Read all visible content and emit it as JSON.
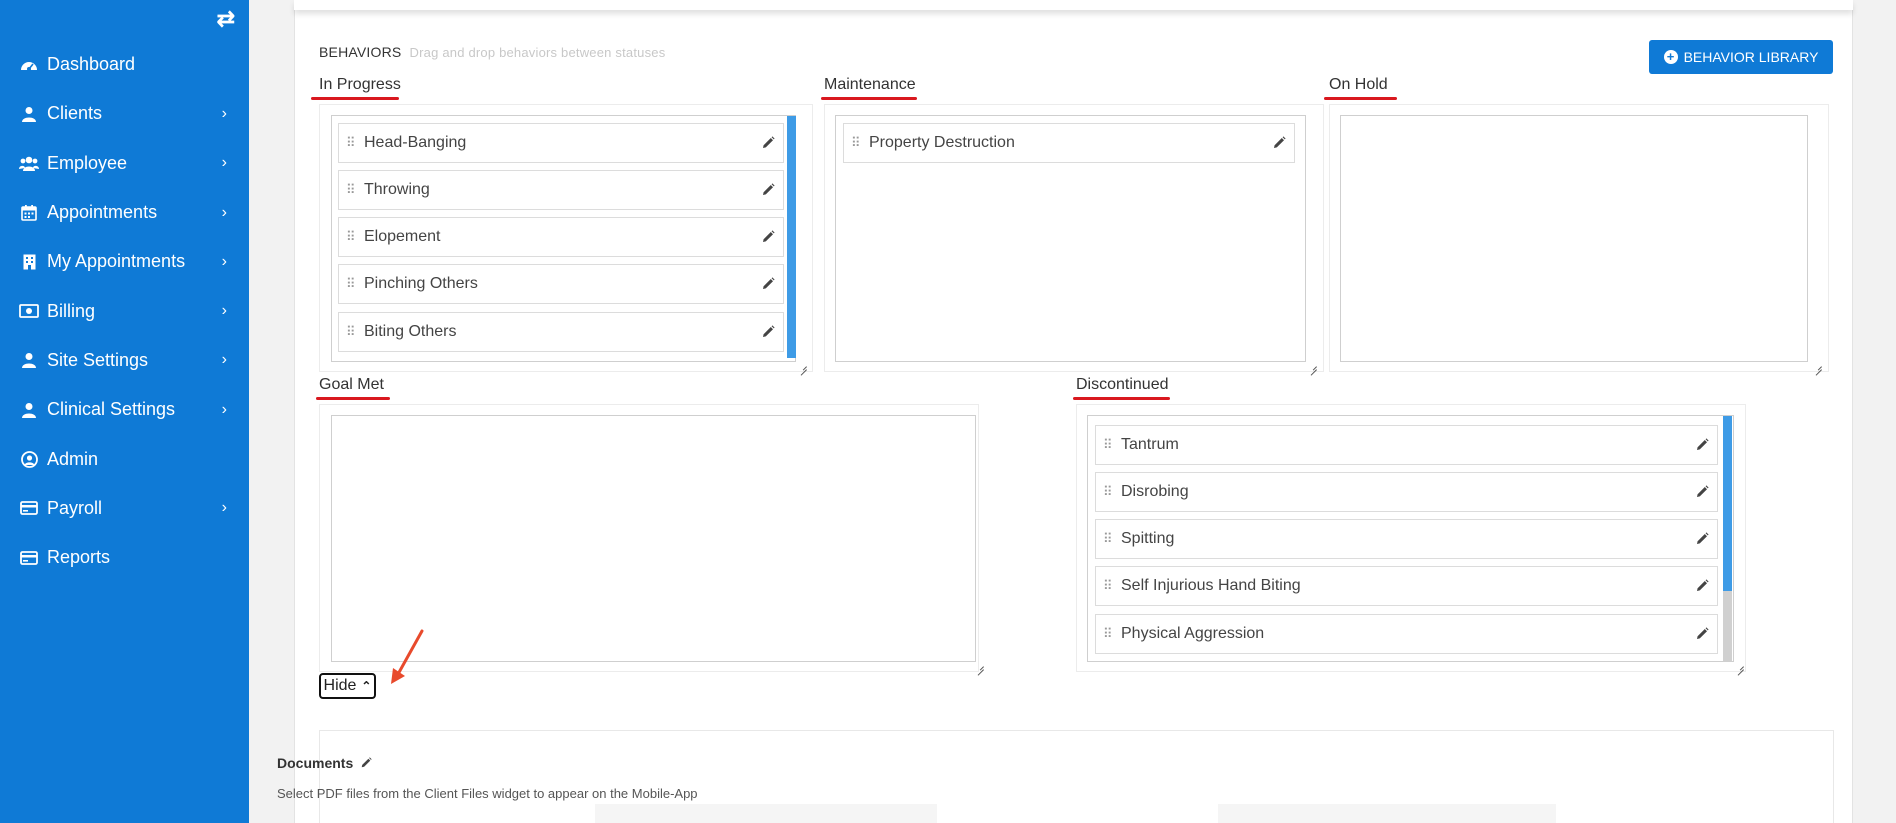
{
  "sidebar": {
    "items": [
      {
        "label": "Dashboard",
        "icon": "dashboard-icon",
        "has_chevron": false
      },
      {
        "label": "Clients",
        "icon": "user-icon",
        "has_chevron": true
      },
      {
        "label": "Employee",
        "icon": "users-icon",
        "has_chevron": true
      },
      {
        "label": "Appointments",
        "icon": "calendar-icon",
        "has_chevron": true
      },
      {
        "label": "My Appointments",
        "icon": "building-icon",
        "has_chevron": true
      },
      {
        "label": "Billing",
        "icon": "money-icon",
        "has_chevron": true
      },
      {
        "label": "Site Settings",
        "icon": "user-icon",
        "has_chevron": true
      },
      {
        "label": "Clinical Settings",
        "icon": "user-icon",
        "has_chevron": true
      },
      {
        "label": "Admin",
        "icon": "user-circle-icon",
        "has_chevron": false
      },
      {
        "label": "Payroll",
        "icon": "credit-card-icon",
        "has_chevron": true
      },
      {
        "label": "Reports",
        "icon": "credit-card-icon",
        "has_chevron": false
      }
    ]
  },
  "behaviors": {
    "title": "BEHAVIORS",
    "hint": "Drag and drop behaviors between statuses",
    "library_button": "BEHAVIOR LIBRARY",
    "statuses": {
      "in_progress": {
        "label": "In Progress",
        "items": [
          "Head-Banging",
          "Throwing",
          "Elopement",
          "Pinching Others",
          "Biting Others"
        ]
      },
      "maintenance": {
        "label": "Maintenance",
        "items": [
          "Property Destruction"
        ]
      },
      "on_hold": {
        "label": "On Hold",
        "items": []
      },
      "goal_met": {
        "label": "Goal Met",
        "items": []
      },
      "discontinued": {
        "label": "Discontinued",
        "items": [
          "Tantrum",
          "Disrobing",
          "Spitting",
          "Self Injurious Hand Biting",
          "Physical Aggression"
        ]
      }
    },
    "hide_button": "Hide"
  },
  "documents": {
    "title": "Documents",
    "subtitle": "Select PDF files from the Client Files widget to appear on the Mobile-App"
  },
  "colors": {
    "sidebar": "#0f7ad6",
    "accent": "#0f7ad6",
    "underline": "#d9181f",
    "annotation_arrow": "#e84a2c"
  }
}
